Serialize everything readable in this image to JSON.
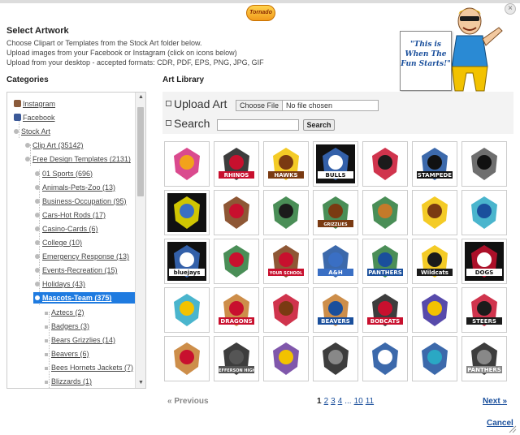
{
  "colors": {
    "accent": "#1f7be0",
    "link": "#1a4f9c",
    "panel": "#f3f3f3"
  },
  "window": {
    "close_icon": "close-icon",
    "close_glyph": "×"
  },
  "logo": {
    "text": "Tornado"
  },
  "header": {
    "title": "Select Artwork",
    "lines": [
      "Choose Clipart or Templates from the Stock Art folder below.",
      "Upload images from your Facebook or Instagram (click on icons below)",
      "Upload from your desktop - accepted formats: CDR, PDF, EPS, PNG, JPG, GIF"
    ]
  },
  "mascot": {
    "speech": "\"This is When The Fun Starts!\""
  },
  "categories": {
    "label": "Categories",
    "items": [
      {
        "label": "Instagram",
        "icon": "instagram-icon"
      },
      {
        "label": "Facebook",
        "icon": "facebook-icon"
      },
      {
        "label": "Stock Art"
      },
      {
        "label": "Clip Art (35142)"
      },
      {
        "label": "Free Design Templates (2131)"
      },
      {
        "label": "01 Sports (696)"
      },
      {
        "label": "Animals-Pets-Zoo (13)"
      },
      {
        "label": "Business-Occupation (95)"
      },
      {
        "label": "Cars-Hot Rods (17)"
      },
      {
        "label": "Casino-Cards (6)"
      },
      {
        "label": "College (10)"
      },
      {
        "label": "Emergency Response (13)"
      },
      {
        "label": "Events-Recreation (15)"
      },
      {
        "label": "Holidays (43)"
      },
      {
        "label": "Mascots-Team (375)",
        "selected": true
      },
      {
        "label": "Aztecs (2)"
      },
      {
        "label": "Badgers (3)"
      },
      {
        "label": "Bears Grizzlies (14)"
      },
      {
        "label": "Beavers (6)"
      },
      {
        "label": "Bees Hornets Jackets (7)"
      },
      {
        "label": "Blizzards (1)"
      }
    ],
    "scroll_up": "▲",
    "scroll_down": "▼"
  },
  "library": {
    "label": "Art Library",
    "upload_label": "Upload Art",
    "choose_file": "Choose File",
    "no_file": "No file chosen",
    "search_label": "Search",
    "search_placeholder": "",
    "search_button": "Search"
  },
  "thumbnails": [
    {
      "text": "",
      "bg": "#ffffff",
      "c1": "#d42a7a",
      "c2": "#f2a21b"
    },
    {
      "text": "RHINOS",
      "bg": "#ffffff",
      "c1": "#1b1b1b",
      "c2": "#c8102e"
    },
    {
      "text": "HAWKS",
      "bg": "#ffffff",
      "c1": "#f2c200",
      "c2": "#7a3a12"
    },
    {
      "text": "BULLS",
      "bg": "#111111",
      "c1": "#3a6fc4",
      "c2": "#ffffff"
    },
    {
      "text": "",
      "bg": "#ffffff",
      "c1": "#c8102e",
      "c2": "#1b1b1b"
    },
    {
      "text": "STAMPEDE",
      "bg": "#ffffff",
      "c1": "#1a4f9c",
      "c2": "#111111"
    },
    {
      "text": "",
      "bg": "#ffffff",
      "c1": "#555555",
      "c2": "#111111"
    },
    {
      "text": "",
      "bg": "#111111",
      "c1": "#f2e600",
      "c2": "#3a6fc4"
    },
    {
      "text": "",
      "bg": "#ffffff",
      "c1": "#7a3a12",
      "c2": "#c8102e"
    },
    {
      "text": "",
      "bg": "#ffffff",
      "c1": "#2a7a3a",
      "c2": "#1b1b1b"
    },
    {
      "text": "GRIZZLIES",
      "bg": "#ffffff",
      "c1": "#2a7a3a",
      "c2": "#7a3a12"
    },
    {
      "text": "",
      "bg": "#ffffff",
      "c1": "#2a7a3a",
      "c2": "#c47a2a"
    },
    {
      "text": "",
      "bg": "#ffffff",
      "c1": "#f2c200",
      "c2": "#7a3a12"
    },
    {
      "text": "",
      "bg": "#ffffff",
      "c1": "#2aa8c4",
      "c2": "#1a4f9c"
    },
    {
      "text": "bluejays",
      "bg": "#111111",
      "c1": "#3a6fc4",
      "c2": "#ffffff"
    },
    {
      "text": "",
      "bg": "#ffffff",
      "c1": "#2a7a3a",
      "c2": "#c8102e"
    },
    {
      "text": "YOUR SCHOOL",
      "bg": "#ffffff",
      "c1": "#7a3a12",
      "c2": "#c8102e"
    },
    {
      "text": "A&H",
      "bg": "#ffffff",
      "c1": "#1a4f9c",
      "c2": "#3a6fc4"
    },
    {
      "text": "PANTHERS",
      "bg": "#ffffff",
      "c1": "#2a7a3a",
      "c2": "#1a4f9c"
    },
    {
      "text": "Wildcats",
      "bg": "#ffffff",
      "c1": "#f2c200",
      "c2": "#1b1b1b"
    },
    {
      "text": "DOGS",
      "bg": "#111111",
      "c1": "#c8102e",
      "c2": "#ffffff"
    },
    {
      "text": "",
      "bg": "#ffffff",
      "c1": "#2aa8c4",
      "c2": "#f2c200"
    },
    {
      "text": "DRAGONS",
      "bg": "#ffffff",
      "c1": "#c47a2a",
      "c2": "#c8102e"
    },
    {
      "text": "",
      "bg": "#ffffff",
      "c1": "#c8102e",
      "c2": "#7a3a12"
    },
    {
      "text": "BEAVERS",
      "bg": "#ffffff",
      "c1": "#c47a2a",
      "c2": "#1a4f9c"
    },
    {
      "text": "BOBCATS",
      "bg": "#ffffff",
      "c1": "#1b1b1b",
      "c2": "#c8102e"
    },
    {
      "text": "",
      "bg": "#ffffff",
      "c1": "#3a2a9c",
      "c2": "#f2c200"
    },
    {
      "text": "STEERS",
      "bg": "#ffffff",
      "c1": "#c8102e",
      "c2": "#1b1b1b"
    },
    {
      "text": "",
      "bg": "#ffffff",
      "c1": "#c47a2a",
      "c2": "#c8102e"
    },
    {
      "text": "JEFFERSON HIGH",
      "bg": "#ffffff",
      "c1": "#1b1b1b",
      "c2": "#555555"
    },
    {
      "text": "",
      "bg": "#ffffff",
      "c1": "#6a3a9c",
      "c2": "#f2c200"
    },
    {
      "text": "",
      "bg": "#ffffff",
      "c1": "#1b1b1b",
      "c2": "#888888"
    },
    {
      "text": "",
      "bg": "#ffffff",
      "c1": "#1a4f9c",
      "c2": "#ffffff"
    },
    {
      "text": "",
      "bg": "#ffffff",
      "c1": "#1a4f9c",
      "c2": "#2aa8c4"
    },
    {
      "text": "PANTHERS",
      "bg": "#ffffff",
      "c1": "#1b1b1b",
      "c2": "#888888"
    }
  ],
  "pager": {
    "prev": "« Previous",
    "pages": [
      "1",
      "2",
      "3",
      "4",
      "...",
      "10",
      "11"
    ],
    "current": "1",
    "next": "Next »"
  },
  "cancel": "Cancel"
}
